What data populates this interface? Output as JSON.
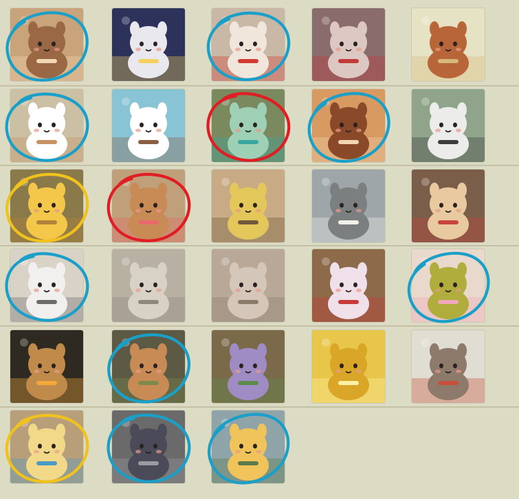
{
  "screen": "achievement-icon-collection",
  "rows": [
    [
      {
        "icon": "shiba-dogs-hug-icon",
        "bg": "#c9a47a",
        "fg": "#9a6844",
        "accent": "#f3d6b3",
        "circle": "blue"
      },
      {
        "icon": "white-cat-starry-icon",
        "bg": "#2c3259",
        "fg": "#e8e8ee",
        "accent": "#f5d25e",
        "circle": null
      },
      {
        "icon": "bunny-drink-icon",
        "bg": "#c8b8a5",
        "fg": "#f1e6dc",
        "accent": "#d33a33",
        "circle": "blue"
      },
      {
        "icon": "rabbit-piano-icon",
        "bg": "#8a6c6c",
        "fg": "#ddc7c3",
        "accent": "#c23a3a",
        "circle": null
      },
      {
        "icon": "fox-sandcastle-icon",
        "bg": "#e6e2c4",
        "fg": "#b9653a",
        "accent": "#d8b87a",
        "circle": null
      }
    ],
    [
      {
        "icon": "guinea-pig-sprout-icon",
        "bg": "#cbbfa4",
        "fg": "#ffffff",
        "accent": "#c79262",
        "circle": "blue"
      },
      {
        "icon": "boat-ocean-icon",
        "bg": "#89c3d6",
        "fg": "#ffffff",
        "accent": "#8a5f44",
        "circle": null
      },
      {
        "icon": "frog-pond-icon",
        "bg": "#7a8a5e",
        "fg": "#9ed0b6",
        "accent": "#3aa6a0",
        "circle": "red"
      },
      {
        "icon": "red-panda-face-icon",
        "bg": "#d99a62",
        "fg": "#8a4a2a",
        "accent": "#f2d5b2",
        "circle": "blue"
      },
      {
        "icon": "panda-noodles-icon",
        "bg": "#8fa48a",
        "fg": "#ececea",
        "accent": "#3c3c3c",
        "circle": null
      }
    ],
    [
      {
        "icon": "pinwheel-icon",
        "bg": "#8a7a4a",
        "fg": "#f3c74a",
        "accent": "#b0823a",
        "circle": "yellow"
      },
      {
        "icon": "shiba-cookie-icon",
        "bg": "#bfa07a",
        "fg": "#c98b55",
        "accent": "#e86a6a",
        "circle": "red"
      },
      {
        "icon": "turtle-hammer-icon",
        "bg": "#c8aa85",
        "fg": "#e3c75a",
        "accent": "#6e5a3a",
        "circle": null
      },
      {
        "icon": "stone-sloth-icon",
        "bg": "#9ea6aa",
        "fg": "#7c7f80",
        "accent": "#f1f1ea",
        "circle": null
      },
      {
        "icon": "apple-core-icon",
        "bg": "#7a5e4a",
        "fg": "#e9c9a0",
        "accent": "#c9453a",
        "circle": null
      }
    ],
    [
      {
        "icon": "raccoon-glasses-icon",
        "bg": "#d8d2c7",
        "fg": "#f1f0ee",
        "accent": "#6c6c6c",
        "circle": "blue"
      },
      {
        "icon": "sleeping-bunny-sketch-icon",
        "bg": "#b7b0a3",
        "fg": "#d8d2c6",
        "accent": "#8f887c",
        "circle": null
      },
      {
        "icon": "capybara-bed-sketch-icon",
        "bg": "#b9a898",
        "fg": "#d4c6b8",
        "accent": "#8a7a6a",
        "circle": null
      },
      {
        "icon": "bunny-scarf-turtle-icon",
        "bg": "#8c6a4a",
        "fg": "#f0e0ea",
        "accent": "#c83a3a",
        "circle": null
      },
      {
        "icon": "turtle-waving-icon",
        "bg": "#e9d8cc",
        "fg": "#b0ad3c",
        "accent": "#f0a8b8",
        "circle": "blue"
      }
    ],
    [
      {
        "icon": "flame-turtle-icon",
        "bg": "#2e2a22",
        "fg": "#c08a4a",
        "accent": "#f3a93a",
        "circle": null
      },
      {
        "icon": "hedgehog-helmet-icon",
        "bg": "#5c5a44",
        "fg": "#c98b55",
        "accent": "#7c8a4a",
        "circle": "blue"
      },
      {
        "icon": "garden-trowel-icon",
        "bg": "#7a6a4a",
        "fg": "#9f8cc4",
        "accent": "#5e8a4a",
        "circle": null
      },
      {
        "icon": "golden-fish-icon",
        "bg": "#e8c64a",
        "fg": "#d9a628",
        "accent": "#fff1a8",
        "circle": null
      },
      {
        "icon": "mole-mushroom-hat-icon",
        "bg": "#e0ddd2",
        "fg": "#8e7a6a",
        "accent": "#c8503a",
        "circle": null
      }
    ],
    [
      {
        "icon": "golden-carrot-icon",
        "bg": "#b99e7a",
        "fg": "#f2d98a",
        "accent": "#4a9ac8",
        "circle": "yellow"
      },
      {
        "icon": "dark-mole-icon",
        "bg": "#6a6a6a",
        "fg": "#4a4a58",
        "accent": "#9a9aa2",
        "circle": "blue"
      },
      {
        "icon": "giraffe-glasses-icon",
        "bg": "#8fa4a8",
        "fg": "#f0c45a",
        "accent": "#5c7a4a",
        "circle": "blue"
      }
    ]
  ],
  "circle_colors": {
    "blue": "#1aa0c8",
    "red": "#e11d24",
    "yellow": "#f1c21b"
  }
}
